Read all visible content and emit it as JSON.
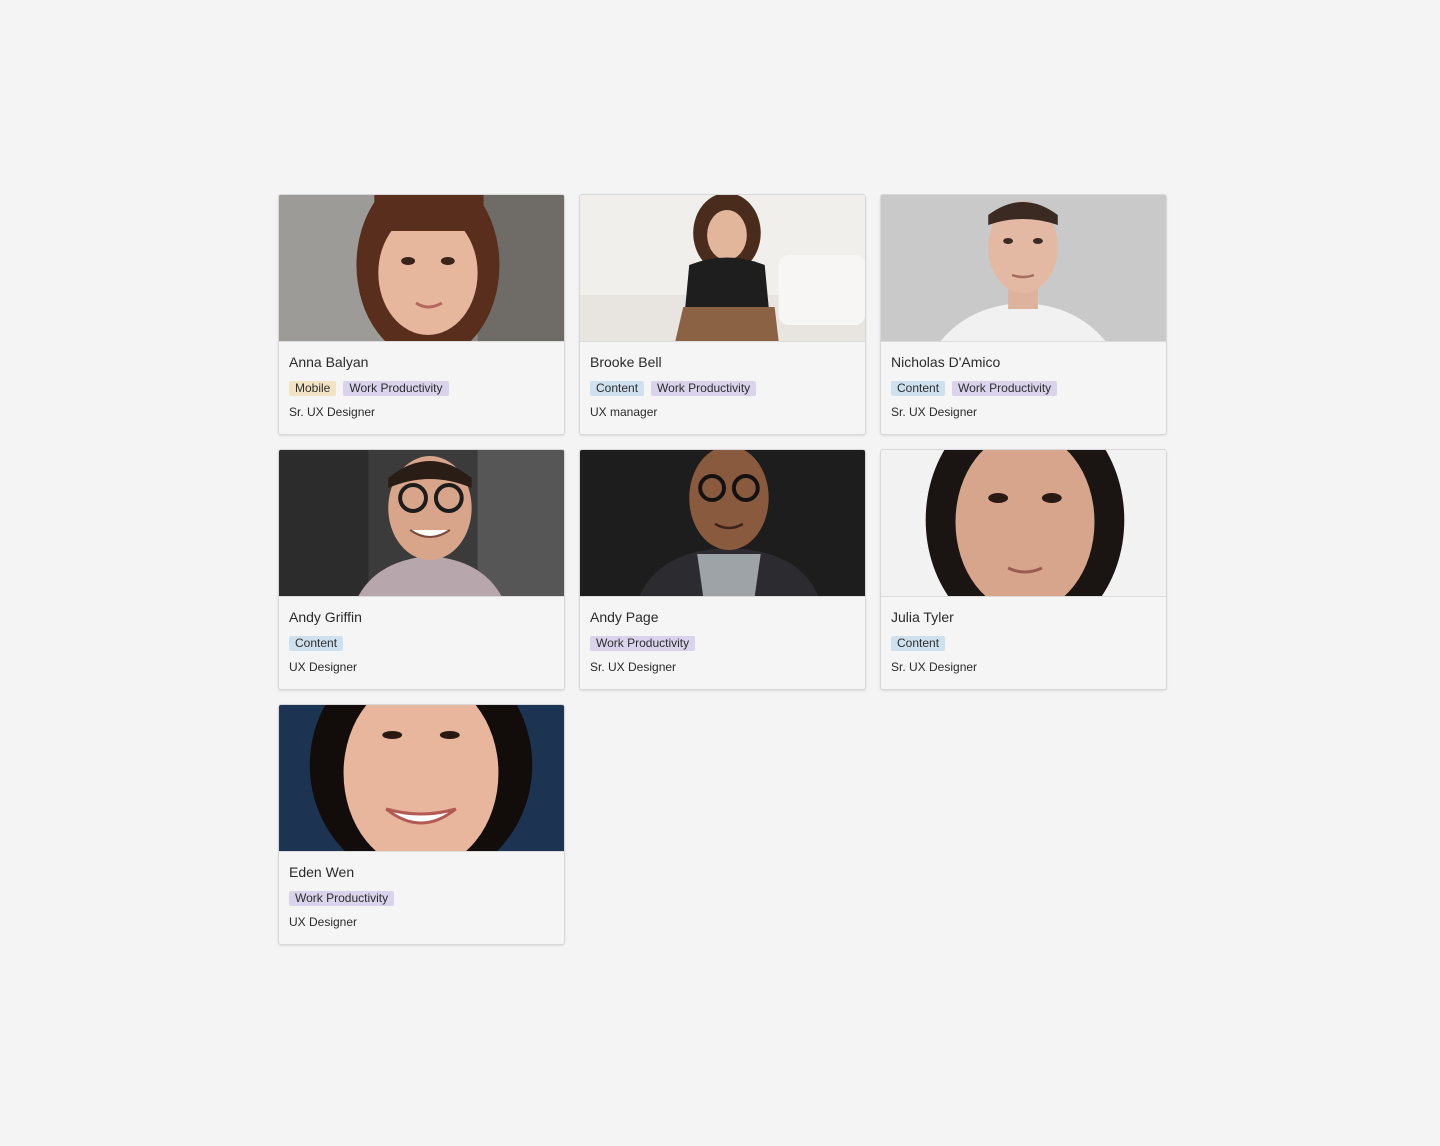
{
  "people": [
    {
      "name": "Anna Balyan",
      "tags": [
        "Mobile",
        "Work Productivity"
      ],
      "role": "Sr. UX Designer"
    },
    {
      "name": "Brooke Bell",
      "tags": [
        "Content",
        "Work Productivity"
      ],
      "role": "UX manager"
    },
    {
      "name": "Nicholas D'Amico",
      "tags": [
        "Content",
        "Work Productivity"
      ],
      "role": "Sr. UX Designer"
    },
    {
      "name": "Andy Griffin",
      "tags": [
        "Content"
      ],
      "role": "UX Designer"
    },
    {
      "name": "Andy Page",
      "tags": [
        "Work Productivity"
      ],
      "role": "Sr. UX Designer"
    },
    {
      "name": "Julia Tyler",
      "tags": [
        "Content"
      ],
      "role": "Sr. UX Designer"
    },
    {
      "name": "Eden Wen",
      "tags": [
        "Work Productivity"
      ],
      "role": "UX Designer"
    }
  ],
  "tag_colors": {
    "Mobile": "#f2e3c4",
    "Content": "#cfe0ee",
    "Work Productivity": "#d9d3ec"
  },
  "page_background": "#f4f4f4"
}
